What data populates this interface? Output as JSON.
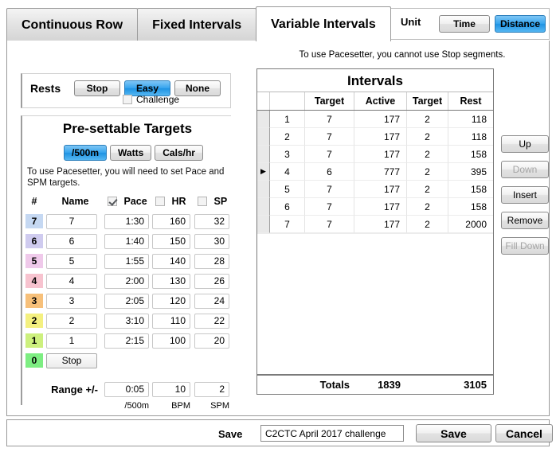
{
  "tabs": [
    {
      "label": "Continuous Row",
      "active": false
    },
    {
      "label": "Fixed Intervals",
      "active": false
    },
    {
      "label": "Variable Intervals",
      "active": true
    }
  ],
  "unit": {
    "label": "Unit",
    "time_label": "Time",
    "distance_label": "Distance",
    "selected": "Distance"
  },
  "rests": {
    "label": "Rests",
    "stop_label": "Stop",
    "easy_label": "Easy",
    "none_label": "None",
    "selected": "Easy",
    "challenge_label": "Challenge",
    "challenge_checked": false
  },
  "targets": {
    "title": "Pre-settable Targets",
    "unit_buttons": [
      {
        "label": "/500m",
        "selected": true
      },
      {
        "label": "Watts",
        "selected": false
      },
      {
        "label": "Cals/hr",
        "selected": false
      }
    ],
    "hint": "To use Pacesetter, you will need to set Pace and SPM targets.",
    "headers": {
      "num": "#",
      "name": "Name",
      "pace": "Pace",
      "hr": "HR",
      "sp": "SP"
    },
    "checks": {
      "pace": true,
      "hr": false,
      "sp": false
    },
    "rows": [
      {
        "num": "7",
        "name": "7",
        "pace": "1:30",
        "hr": "160",
        "sp": "32",
        "color": "#c5d8f2"
      },
      {
        "num": "6",
        "name": "6",
        "pace": "1:40",
        "hr": "150",
        "sp": "30",
        "color": "#cfcbef"
      },
      {
        "num": "5",
        "name": "5",
        "pace": "1:55",
        "hr": "140",
        "sp": "28",
        "color": "#efc9ea"
      },
      {
        "num": "4",
        "name": "4",
        "pace": "2:00",
        "hr": "130",
        "sp": "26",
        "color": "#f7c3cf"
      },
      {
        "num": "3",
        "name": "3",
        "pace": "2:05",
        "hr": "120",
        "sp": "24",
        "color": "#f7c07a"
      },
      {
        "num": "2",
        "name": "2",
        "pace": "3:10",
        "hr": "110",
        "sp": "22",
        "color": "#f4f080"
      },
      {
        "num": "1",
        "name": "1",
        "pace": "2:15",
        "hr": "100",
        "sp": "20",
        "color": "#cdf07e"
      },
      {
        "num": "0",
        "name": "Stop",
        "pace": "",
        "hr": "",
        "sp": "",
        "color": "#7dee82"
      }
    ],
    "range": {
      "label": "Range +/-",
      "pace": "0:05",
      "hr": "10",
      "sp": "2",
      "pace_unit": "/500m",
      "hr_unit": "BPM",
      "sp_unit": "SPM"
    }
  },
  "intervals": {
    "note": "To use Pacesetter, you cannot use Stop segments.",
    "title": "Intervals",
    "headers": [
      "",
      "",
      "Target",
      "Active",
      "Target",
      "Rest"
    ],
    "rows": [
      {
        "idx": "1",
        "target1": "7",
        "active": "177",
        "target2": "2",
        "rest": "118",
        "selected": false
      },
      {
        "idx": "2",
        "target1": "7",
        "active": "177",
        "target2": "2",
        "rest": "118",
        "selected": false
      },
      {
        "idx": "3",
        "target1": "7",
        "active": "177",
        "target2": "2",
        "rest": "158",
        "selected": false
      },
      {
        "idx": "4",
        "target1": "6",
        "active": "777",
        "target2": "2",
        "rest": "395",
        "selected": true
      },
      {
        "idx": "5",
        "target1": "7",
        "active": "177",
        "target2": "2",
        "rest": "158",
        "selected": false
      },
      {
        "idx": "6",
        "target1": "7",
        "active": "177",
        "target2": "2",
        "rest": "158",
        "selected": false
      },
      {
        "idx": "7",
        "target1": "7",
        "active": "177",
        "target2": "2",
        "rest": "2000",
        "selected": false
      }
    ],
    "totals": {
      "label": "Totals",
      "active": "1839",
      "rest": "3105"
    },
    "selection_marker": "▶"
  },
  "side_buttons": [
    {
      "label": "Up",
      "disabled": false
    },
    {
      "label": "Down",
      "disabled": true
    },
    {
      "label": "Insert",
      "disabled": false
    },
    {
      "label": "Remove",
      "disabled": false
    },
    {
      "label": "Fill Down",
      "disabled": true
    }
  ],
  "bottom": {
    "save_label": "Save",
    "filename": "C2CTC April 2017 challenge",
    "save_button": "Save",
    "cancel_button": "Cancel"
  }
}
